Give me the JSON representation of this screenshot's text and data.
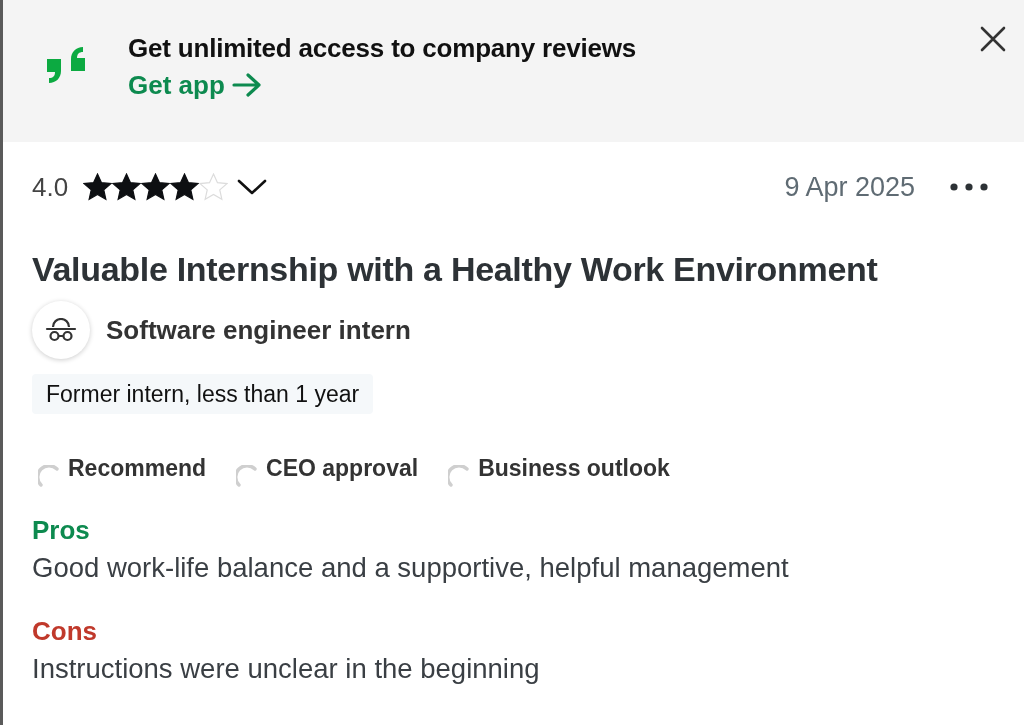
{
  "banner": {
    "title": "Get unlimited access to company reviews",
    "link": "Get app"
  },
  "review": {
    "rating": "4.0",
    "stars": 4,
    "date": "9 Apr 2025",
    "title": "Valuable Internship with a Healthy Work Environment",
    "role": "Software engineer intern",
    "tenure": "Former intern, less than 1 year",
    "indicators": [
      {
        "label": "Recommend"
      },
      {
        "label": "CEO approval"
      },
      {
        "label": "Business outlook"
      }
    ],
    "sections": [
      {
        "kind": "pros",
        "heading": "Pros",
        "text": "Good work-life balance and a supportive, helpful management"
      },
      {
        "kind": "cons",
        "heading": "Cons",
        "text": "Instructions were unclear in the beginning"
      }
    ]
  }
}
